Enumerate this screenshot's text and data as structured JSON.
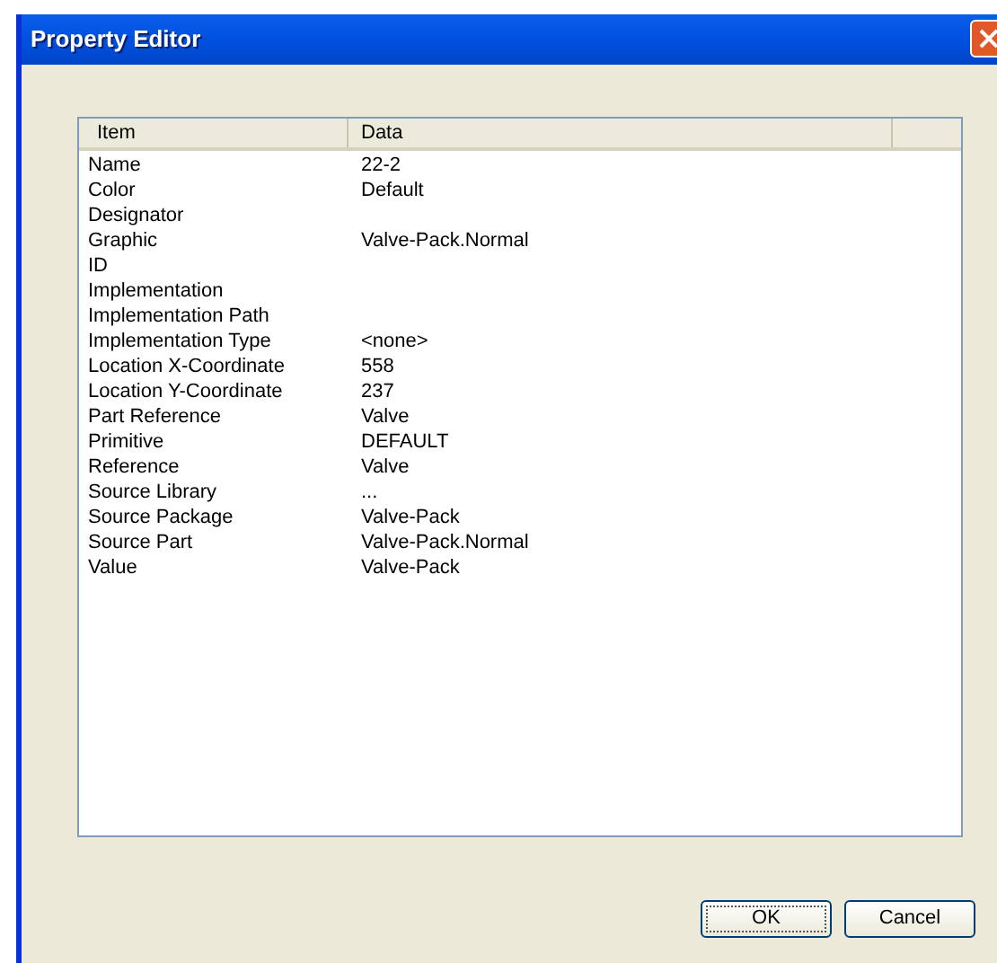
{
  "window": {
    "title": "Property Editor"
  },
  "table": {
    "columns": [
      "Item",
      "Data"
    ],
    "rows": [
      {
        "item": "Name",
        "data": "22-2"
      },
      {
        "item": "Color",
        "data": "Default"
      },
      {
        "item": "Designator",
        "data": ""
      },
      {
        "item": "Graphic",
        "data": "Valve-Pack.Normal"
      },
      {
        "item": "ID",
        "data": ""
      },
      {
        "item": "Implementation",
        "data": ""
      },
      {
        "item": "Implementation Path",
        "data": ""
      },
      {
        "item": "Implementation Type",
        "data": "<none>"
      },
      {
        "item": "Location X-Coordinate",
        "data": "558"
      },
      {
        "item": "Location Y-Coordinate",
        "data": "237"
      },
      {
        "item": "Part Reference",
        "data": "Valve"
      },
      {
        "item": "Primitive",
        "data": "DEFAULT"
      },
      {
        "item": "Reference",
        "data": "Valve"
      },
      {
        "item": "Source Library",
        "data": "..."
      },
      {
        "item": "Source Package",
        "data": "Valve-Pack"
      },
      {
        "item": "Source Part",
        "data": "Valve-Pack.Normal"
      },
      {
        "item": "Value",
        "data": "Valve-Pack"
      }
    ]
  },
  "buttons": [
    {
      "label": "OK",
      "default": true
    },
    {
      "label": "Cancel",
      "default": false
    }
  ]
}
